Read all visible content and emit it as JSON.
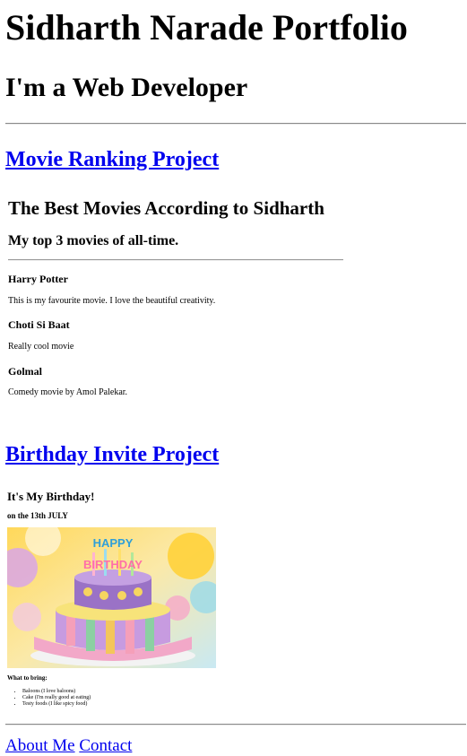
{
  "header": {
    "title": "Sidharth Narade Portfolio",
    "subtitle": "I'm a Web Developer"
  },
  "projects": {
    "movie_link": "Movie Ranking Project",
    "birthday_link": "Birthday Invite Project"
  },
  "movies": {
    "heading": "The Best Movies According to Sidharth",
    "subheading": "My top 3 movies of all-time.",
    "items": [
      {
        "title": "Harry Potter",
        "description": "This is my favourite movie. I love the beautiful creativity."
      },
      {
        "title": "Choti Si Baat",
        "description": "Really cool movie"
      },
      {
        "title": "Golmal",
        "description": "Comedy movie by Amol Palekar."
      }
    ]
  },
  "birthday": {
    "heading": "It's My Birthday!",
    "date": "on the 13th JULY",
    "image_text": "HAPPY BIRTHDAY",
    "bring_heading": "What to bring:",
    "bring_items": [
      "Baloons (I love baloons)",
      "Cake (I'm really good at eating)",
      "Testy foods (I like spicy food)"
    ]
  },
  "footer": {
    "about": "About Me",
    "contact": "Contact"
  },
  "colors": {
    "link": "#0000ee",
    "rule": "#8a8a8a"
  }
}
